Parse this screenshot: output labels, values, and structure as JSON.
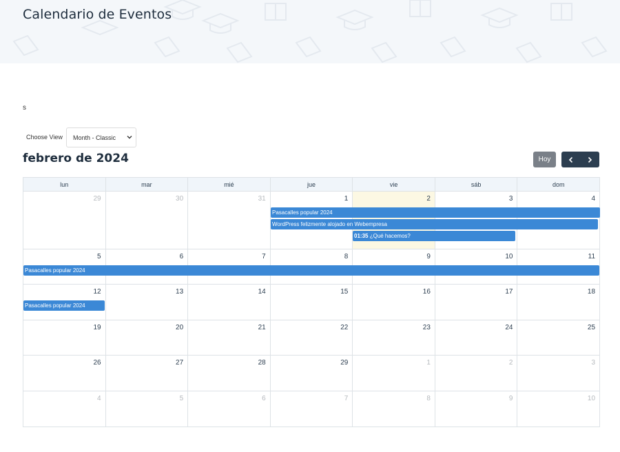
{
  "page": {
    "title": "Calendario de Eventos",
    "stray_text": "s"
  },
  "toolbar": {
    "view_label": "Choose View",
    "view_selected": "Month - Classic",
    "month_title": "febrero de 2024",
    "today_label": "Hoy",
    "prev_icon": "chevron-left-icon",
    "next_icon": "chevron-right-icon"
  },
  "calendar": {
    "days_of_week": [
      "lun",
      "mar",
      "mié",
      "jue",
      "vie",
      "sáb",
      "dom"
    ],
    "weeks": [
      {
        "days": [
          {
            "n": "29",
            "other": true
          },
          {
            "n": "30",
            "other": true
          },
          {
            "n": "31",
            "other": true
          },
          {
            "n": "1",
            "other": false
          },
          {
            "n": "2",
            "other": false,
            "today": true
          },
          {
            "n": "3",
            "other": false
          },
          {
            "n": "4",
            "other": false
          }
        ]
      },
      {
        "days": [
          {
            "n": "5",
            "other": false
          },
          {
            "n": "6",
            "other": false
          },
          {
            "n": "7",
            "other": false
          },
          {
            "n": "8",
            "other": false
          },
          {
            "n": "9",
            "other": false
          },
          {
            "n": "10",
            "other": false
          },
          {
            "n": "11",
            "other": false
          }
        ]
      },
      {
        "days": [
          {
            "n": "12",
            "other": false
          },
          {
            "n": "13",
            "other": false
          },
          {
            "n": "14",
            "other": false
          },
          {
            "n": "15",
            "other": false
          },
          {
            "n": "16",
            "other": false
          },
          {
            "n": "17",
            "other": false
          },
          {
            "n": "18",
            "other": false
          }
        ]
      },
      {
        "days": [
          {
            "n": "19",
            "other": false
          },
          {
            "n": "20",
            "other": false
          },
          {
            "n": "21",
            "other": false
          },
          {
            "n": "22",
            "other": false
          },
          {
            "n": "23",
            "other": false
          },
          {
            "n": "24",
            "other": false
          },
          {
            "n": "25",
            "other": false
          }
        ]
      },
      {
        "days": [
          {
            "n": "26",
            "other": false
          },
          {
            "n": "27",
            "other": false
          },
          {
            "n": "28",
            "other": false
          },
          {
            "n": "29",
            "other": false
          },
          {
            "n": "1",
            "other": true
          },
          {
            "n": "2",
            "other": true
          },
          {
            "n": "3",
            "other": true
          }
        ]
      },
      {
        "days": [
          {
            "n": "4",
            "other": true
          },
          {
            "n": "5",
            "other": true
          },
          {
            "n": "6",
            "other": true
          },
          {
            "n": "7",
            "other": true
          },
          {
            "n": "8",
            "other": true
          },
          {
            "n": "9",
            "other": true
          },
          {
            "n": "10",
            "other": true
          }
        ]
      }
    ],
    "events": [
      {
        "title": "Pasacalles popular 2024",
        "time": ""
      },
      {
        "title": "WordPress felizmente alojado en Webempresa",
        "time": ""
      },
      {
        "title": "¿Qué hacemos?",
        "time": "01:35"
      },
      {
        "title": "Pasacalles popular 2024",
        "time": ""
      },
      {
        "title": "Pasacalles popular 2024",
        "time": ""
      }
    ],
    "event_color": "#3b88d6",
    "today_color": "#fcf8e3"
  }
}
